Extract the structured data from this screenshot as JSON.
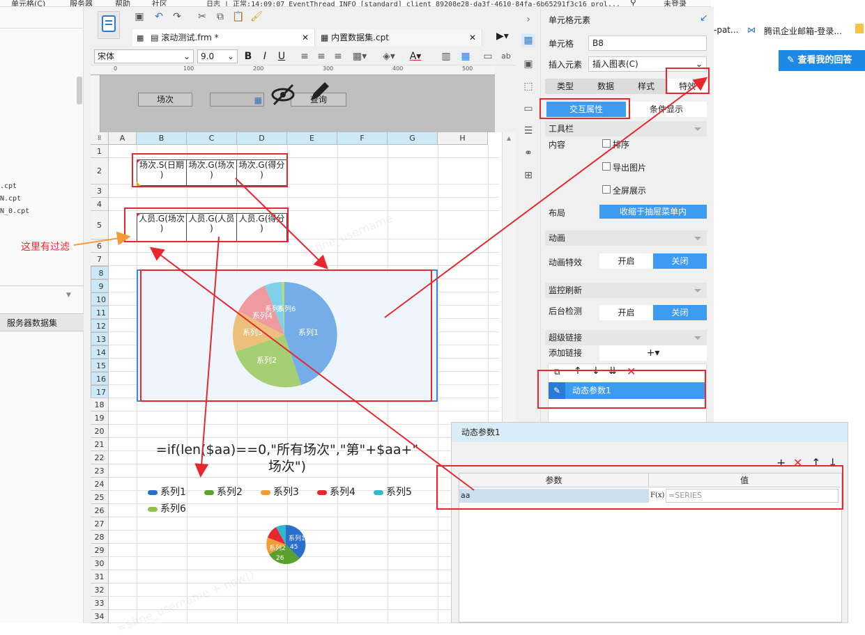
{
  "menubar": {
    "items": [
      "单元格(C)",
      "服务器",
      "帮助",
      "社区"
    ],
    "log_text": "日志 | 正常:14:09:07 EventThread INFO [standard] client 89208e28-da3f-4610-84fa-6b65291f3c16 prol...",
    "login": "未登录"
  },
  "left_panel": {
    "files": [
      ".cpt",
      "N.cpt",
      "N_0.cpt"
    ],
    "tab": "服务器数据集"
  },
  "doc_tabs": [
    {
      "label": "滚动测试.frm *"
    },
    {
      "label": "内置数据集.cpt"
    }
  ],
  "format": {
    "font": "宋体",
    "size": "9.0"
  },
  "ruler": [
    "0",
    "100",
    "200",
    "300",
    "400",
    "500"
  ],
  "params": {
    "label": "场次",
    "query_button": "查询"
  },
  "grid": {
    "columns": [
      "A",
      "B",
      "C",
      "D",
      "E",
      "F",
      "G",
      "H"
    ],
    "rows": [
      "1",
      "2",
      "3",
      "4",
      "5",
      "6",
      "7",
      "8",
      "9",
      "10",
      "11",
      "12",
      "13",
      "14",
      "15",
      "16",
      "17",
      "18",
      "19",
      "20",
      "21",
      "22",
      "23",
      "24",
      "25",
      "26",
      "27",
      "28",
      "29",
      "30",
      "31",
      "32",
      "33",
      "34"
    ],
    "row2": [
      "场次.S(日期 )",
      "场次.G(场次 )",
      "场次.G(得分 )"
    ],
    "row5": [
      "人员.G(场次 )",
      "人员.G(人员 )",
      "人员.G(得分 )"
    ]
  },
  "annotation": "这里有过滤",
  "chart_design": {
    "slices": [
      "系列1",
      "系列2",
      "系列3",
      "系列4",
      "系列5",
      "系列6"
    ]
  },
  "formula": {
    "line1": "=if(len($aa)==0,\"所有场次\",\"第\"+$aa+\"",
    "line2": "场次\")"
  },
  "preview_legend": [
    "系列1",
    "系列2",
    "系列3",
    "系列4",
    "系列5",
    "系列6"
  ],
  "preview_pie": {
    "labels": [
      "系列1",
      "系列2",
      "45",
      "26"
    ]
  },
  "watermarks": [
    "=$fine_username + now()",
    "=$fine_username",
    "=$fine_username + now()"
  ],
  "props": {
    "header": "单元格元素",
    "cell_label": "单元格",
    "cell_value": "B8",
    "insert_label": "插入元素",
    "insert_value": "插入图表(C)",
    "tabs": [
      "类型",
      "数据",
      "样式",
      "特效"
    ],
    "subtabs": [
      "交互属性",
      "条件显示"
    ],
    "toolbar_section": "工具栏",
    "content_label": "内容",
    "checks": [
      "排序",
      "导出图片",
      "全屏展示"
    ],
    "layout_label": "布局",
    "layout_value": "收缩于抽屉菜单内",
    "anim_section": "动画",
    "anim_label": "动画特效",
    "on": "开启",
    "off": "关闭",
    "monitor_section": "监控刷新",
    "monitor_label": "后台检测",
    "link_section": "超级链接",
    "add_link_label": "添加链接",
    "add_symbol": "+▾",
    "link_item": "动态参数1"
  },
  "dialog": {
    "title": "动态参数1",
    "col_param": "参数",
    "col_value": "值",
    "param_name": "aa",
    "fx": "F(x)",
    "value": "=SERIES"
  },
  "browser": {
    "tab_text": "-pat...",
    "mail": "腾讯企业邮箱-登录...",
    "button": "查看我的回答"
  },
  "colors": {
    "accent": "#3d9bf2",
    "annotation": "#e8262e",
    "arrow_orange": "#f39c35"
  }
}
